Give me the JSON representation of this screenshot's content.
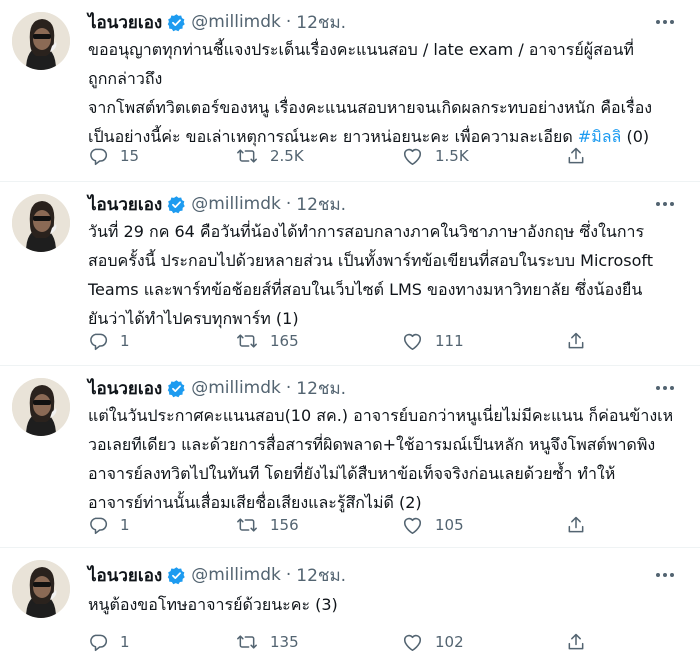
{
  "colors": {
    "text": "#0f1419",
    "secondary": "#536471",
    "accent": "#1d9bf0",
    "divider": "#eff3f4"
  },
  "icons": {
    "reply": "reply-icon",
    "retweet": "retweet-icon",
    "like": "heart-icon",
    "share": "share-icon",
    "more": "more-icon",
    "verified": "verified-badge-icon"
  },
  "tweets": [
    {
      "name": "ไอนวยเอง",
      "handle": "@millimdk",
      "dot": "·",
      "time": "12ชม.",
      "lines": [
        "ขออนุญาตทุกท่านชี้แจงประเด็นเรื่องคะแนนสอบ / late exam / อาจารย์ผู้สอนที่",
        "ถูกกล่าวถึง",
        "จากโพสต์ทวิตเตอร์ของหนู เรื่องคะแนนสอบหายจนเกิดผลกระทบอย่างหนัก คือเรื่อง",
        "เป็นอย่างนี้ค่ะ ขอเล่าเหตุการณ์นะคะ ยาวหน่อยนะคะ เพื่อความละเอียด "
      ],
      "hashtag": "#มิลลิ",
      "tail": " (0)",
      "replies": "15",
      "retweets": "2.5K",
      "likes": "1.5K"
    },
    {
      "name": "ไอนวยเอง",
      "handle": "@millimdk",
      "dot": "·",
      "time": "12ชม.",
      "lines": [
        "วันที่ 29 กค 64 คือวันที่น้องได้ทำการสอบกลางภาคในวิชาภาษาอังกฤษ ซึ่งในการ",
        "สอบครั้งนี้ ประกอบไปด้วยหลายส่วน เป็นทั้งพาร์ทข้อเขียนที่สอบในระบบ Microsoft",
        "Teams และพาร์ทข้อช้อยส์ที่สอบในเว็บไซต์ LMS ของทางมหาวิทยาลัย ซึ่งน้องยืน",
        "ยันว่าได้ทำไปครบทุกพาร์ท (1)"
      ],
      "replies": "1",
      "retweets": "165",
      "likes": "111"
    },
    {
      "name": "ไอนวยเอง",
      "handle": "@millimdk",
      "dot": "·",
      "time": "12ชม.",
      "lines": [
        "แต่ในวันประกาศคะแนนสอบ(10 สค.) อาจารย์บอกว่าหนูเนี่ยไม่มีคะแนน ก็ค่อนข้างเห",
        "วอเลยทีเดียว และด้วยการสื่อสารที่ผิดพลาด+ใช้อารมณ์เป็นหลัก หนูจึงโพสต์พาดพิง",
        "อาจารย์ลงทวิตไปในทันที โดยที่ยังไม่ได้สืบหาข้อเท็จจริงก่อนเลยด้วยซ้ำ ทำให้",
        "อาจารย์ท่านนั้นเสื่อมเสียชื่อเสียงและรู้สึกไม่ดี (2)"
      ],
      "replies": "1",
      "retweets": "156",
      "likes": "105"
    },
    {
      "name": "ไอนวยเอง",
      "handle": "@millimdk",
      "dot": "·",
      "time": "12ชม.",
      "lines": [
        "หนูต้องขอโทษอาจารย์ด้วยนะคะ (3)"
      ],
      "replies": "1",
      "retweets": "135",
      "likes": "102"
    }
  ]
}
